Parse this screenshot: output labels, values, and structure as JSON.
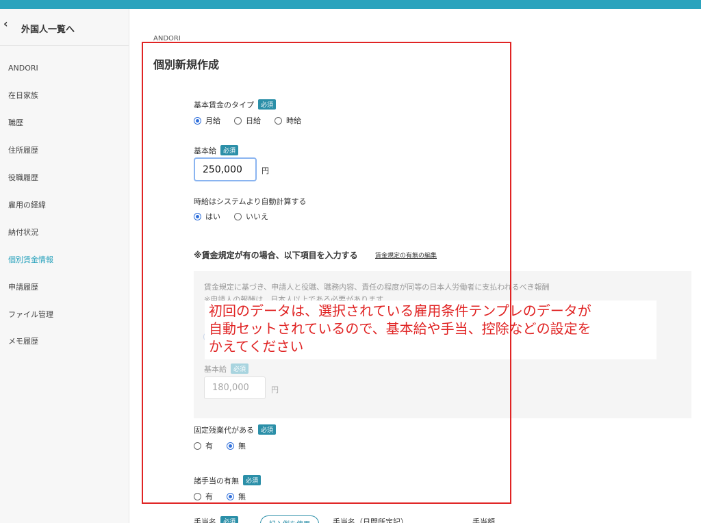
{
  "sidebar": {
    "back_label": "外国人一覧へ",
    "items": [
      {
        "label": "ANDORI"
      },
      {
        "label": "在日家族"
      },
      {
        "label": "職歴"
      },
      {
        "label": "住所履歴"
      },
      {
        "label": "役職履歴"
      },
      {
        "label": "雇用の経緯"
      },
      {
        "label": "納付状況"
      },
      {
        "label": "個別賃金情報",
        "active": true
      },
      {
        "label": "申請履歴"
      },
      {
        "label": "ファイル管理"
      },
      {
        "label": "メモ履歴"
      }
    ]
  },
  "breadcrumb": "ANDORI",
  "page_title": "個別新規作成",
  "required_badge": "必須",
  "wage_type": {
    "label": "基本賃金のタイプ",
    "options": [
      "月給",
      "日給",
      "時給"
    ],
    "selected": "月給"
  },
  "base_salary": {
    "label": "基本給",
    "value": "250,000",
    "unit": "円"
  },
  "hourly_auto": {
    "label": "時給はシステムより自動計算する",
    "options": [
      "はい",
      "いいえ"
    ],
    "selected": "はい"
  },
  "wage_rule": {
    "heading": "※賃金規定が有の場合、以下項目を入力する",
    "edit_link": "賃金規定の有無の編集",
    "note_line1": "賃金規定に基づき、申請人と役職、職務内容、責任の程度が同等の日本人労働者に支払われるべき報酬",
    "note_line2": "※申請人の報酬は、日本人以上である必要があります",
    "salary_label": "基本給",
    "salary_value": "180,000",
    "salary_unit": "円"
  },
  "fixed_overtime": {
    "label": "固定残業代がある",
    "options": [
      "有",
      "無"
    ],
    "selected": "無"
  },
  "allowances": {
    "label": "諸手当の有無",
    "options": [
      "有",
      "無"
    ],
    "selected": "無"
  },
  "annotation": {
    "line1": "初回のデータは、選択されている雇用条件テンプレのデータが",
    "line2": "自動セットされているので、基本給や手当、控除などの設定を",
    "line3": "かえてください"
  },
  "bottom": {
    "allowance_name_label": "手当名",
    "pill_button": "記入例を使用",
    "column_name": "手当名（日間所定記）",
    "column_amount": "手当額"
  },
  "colors": {
    "accent": "#2ba3bd",
    "badge": "#2b8fa8",
    "annotation_red": "#e02424",
    "radio_blue": "#2f6fdb"
  }
}
